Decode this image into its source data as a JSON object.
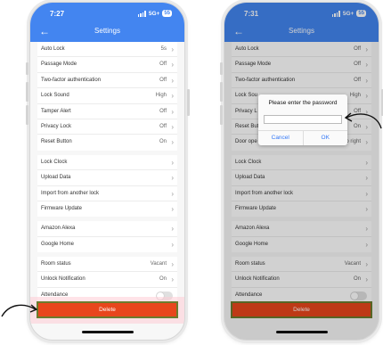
{
  "left": {
    "status": {
      "time": "7:27",
      "network": "5G+",
      "battery": "55"
    },
    "title": "Settings",
    "groups": [
      [
        {
          "label": "Auto Lock",
          "value": "5s"
        },
        {
          "label": "Passage Mode",
          "value": "Off"
        },
        {
          "label": "Two-factor authentication",
          "value": "Off"
        },
        {
          "label": "Lock Sound",
          "value": "High"
        },
        {
          "label": "Tamper Alert",
          "value": "Off"
        },
        {
          "label": "Privacy Lock",
          "value": "Off"
        },
        {
          "label": "Reset Button",
          "value": "On"
        }
      ],
      [
        {
          "label": "Lock Clock"
        },
        {
          "label": "Upload Data"
        },
        {
          "label": "Import from another lock"
        },
        {
          "label": "Firmware Update"
        }
      ],
      [
        {
          "label": "Amazon Alexa"
        },
        {
          "label": "Google Home"
        }
      ],
      [
        {
          "label": "Room status",
          "value": "Vacant"
        },
        {
          "label": "Unlock Notification",
          "value": "On"
        },
        {
          "label": "Attendance"
        }
      ]
    ],
    "delete_label": "Delete"
  },
  "right": {
    "status": {
      "time": "7:31",
      "network": "5G+",
      "battery": "55"
    },
    "title": "Settings",
    "groups": [
      [
        {
          "label": "Auto Lock",
          "value": "Off"
        },
        {
          "label": "Passage Mode",
          "value": "Off"
        },
        {
          "label": "Two-factor authentication",
          "value": "Off"
        },
        {
          "label": "Lock Sou",
          "value": "High"
        },
        {
          "label": "Privacy L",
          "value": "Off"
        },
        {
          "label": "Reset Butt",
          "value": "On"
        },
        {
          "label": "Door ope",
          "value": "to right"
        }
      ],
      [
        {
          "label": "Lock Clock"
        },
        {
          "label": "Upload Data"
        },
        {
          "label": "Import from another lock"
        },
        {
          "label": "Firmware Update"
        }
      ],
      [
        {
          "label": "Amazon Alexa"
        },
        {
          "label": "Google Home"
        }
      ],
      [
        {
          "label": "Room status",
          "value": "Vacant"
        },
        {
          "label": "Unlock Notification",
          "value": "On"
        },
        {
          "label": "Attendance"
        }
      ]
    ],
    "dialog": {
      "title": "Please enter the password",
      "cancel": "Cancel",
      "ok": "OK"
    },
    "delete_label": "Delete"
  },
  "colors": {
    "header": "#4385f0",
    "delete": "#e8461c",
    "accent": "#3478f6"
  }
}
